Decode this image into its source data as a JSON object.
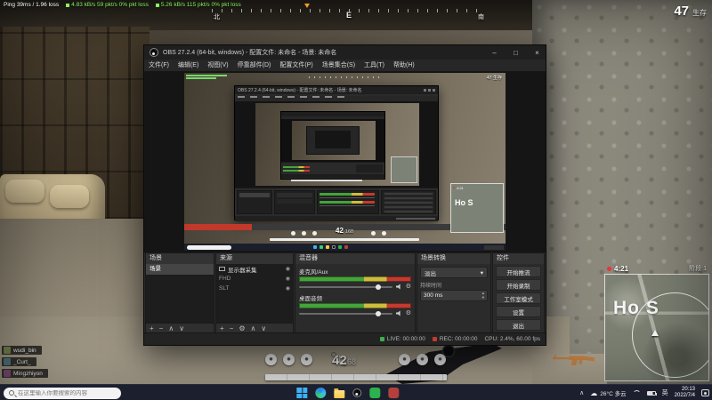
{
  "hud": {
    "ping": "Ping 39ms / 1.96 loss",
    "net1": "4.83 kB/s 59 pkt/s 0% pkt loss",
    "net2": "5.26 kB/s 115 pkt/s 0% pkt loss",
    "alive_count": "47",
    "alive_label": "生存",
    "compass_n": "北",
    "compass_e": "E",
    "compass_s": "南",
    "ammo_mag": "42",
    "ammo_reserve": "168",
    "minimap_timer": "4:21",
    "minimap_phase": "阶段 1",
    "minimap_label": "Ho S",
    "chat": [
      "wudi_bin",
      "_Curt_",
      "Mingzhiyon"
    ]
  },
  "obs": {
    "title": "OBS 27.2.4 (64-bit, windows) - 配置文件: 未命名 - 场景: 未命名",
    "menus": [
      "文件(F)",
      "编辑(E)",
      "视图(V)",
      "停靠部件(D)",
      "配置文件(P)",
      "场景集合(S)",
      "工具(T)",
      "帮助(H)"
    ],
    "scenes": {
      "title": "场景",
      "items": [
        "场景"
      ]
    },
    "sources": {
      "title": "来源",
      "rows": [
        {
          "name": "显示器采集"
        },
        {
          "name": "FHD"
        },
        {
          "name": "SLT"
        }
      ]
    },
    "mixer": {
      "title": "混音器",
      "channels": [
        {
          "name": "麦克风/Aux"
        },
        {
          "name": "桌面音频"
        }
      ]
    },
    "transitions": {
      "title": "场景转换",
      "selected": "淡出",
      "duration_label": "持续时间",
      "duration": "300 ms"
    },
    "controls": {
      "title": "控件",
      "buttons": [
        "开始推流",
        "开始录制",
        "工作室模式",
        "设置",
        "退出"
      ]
    },
    "statusbar": {
      "live": "LIVE: 00:00:00",
      "rec": "REC: 00:00:00",
      "perf": "CPU: 2.4%, 60.00 fps"
    }
  },
  "taskbar": {
    "search_placeholder": "在这里输入你要搜索的内容",
    "weather": "26°C 多云",
    "ime": "英",
    "time": "20:13",
    "date": "2022/7/4"
  },
  "icons": {
    "minimize": "–",
    "maximize": "□",
    "close": "×",
    "add": "+",
    "remove": "−",
    "up": "∧",
    "down": "∨",
    "gear": "⚙",
    "eye": "◉",
    "caret": "▾",
    "spin_up": "▴",
    "spin_down": "▾",
    "tray_chevron": "∧",
    "cloud": "☁"
  },
  "colors": {
    "accent_red": "#c0392b",
    "meter_green": "#45a33a",
    "meter_yellow": "#cdbd3c",
    "meter_red": "#c43a2f",
    "net_green": "#8cf55e"
  }
}
